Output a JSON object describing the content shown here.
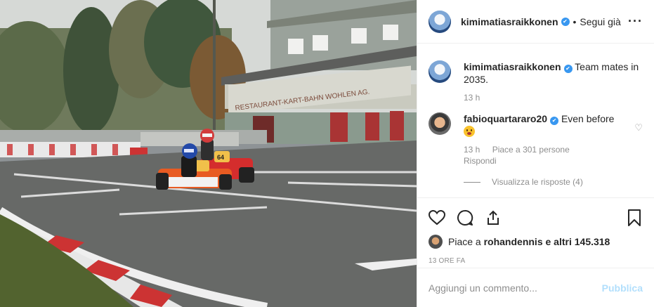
{
  "header": {
    "username": "kimimatiasraikkonen",
    "separator": "•",
    "follow_label": "Segui già",
    "more_icon": "more-horizontal-icon"
  },
  "caption": {
    "username": "kimimatiasraikkonen",
    "text": "Team mates in 2035.",
    "time": "13 h"
  },
  "comment": {
    "username": "fabioquartararo20",
    "text": "Even before",
    "emoji": "grinning-face-emoji",
    "time": "13 h",
    "likes": "Piace a 301 persone",
    "reply_label": "Rispondi",
    "view_replies": "Visualizza le risposte (4)"
  },
  "actions": {
    "likes_prefix": "Piace a",
    "liked_by": "rohandennis",
    "likes_suffix": "e altri 145.318",
    "time_ago": "13 ORE FA"
  },
  "add_comment": {
    "placeholder": "Aggiungi un commento...",
    "publish_label": "Pubblica"
  },
  "photo": {
    "building_sign": "RESTAURANT-KART-BAHN WOHLEN AG.",
    "kart_number": "64"
  },
  "colors": {
    "verified": "#3897f0",
    "publish": "#b2dffc",
    "muted": "#8e8e8e"
  }
}
